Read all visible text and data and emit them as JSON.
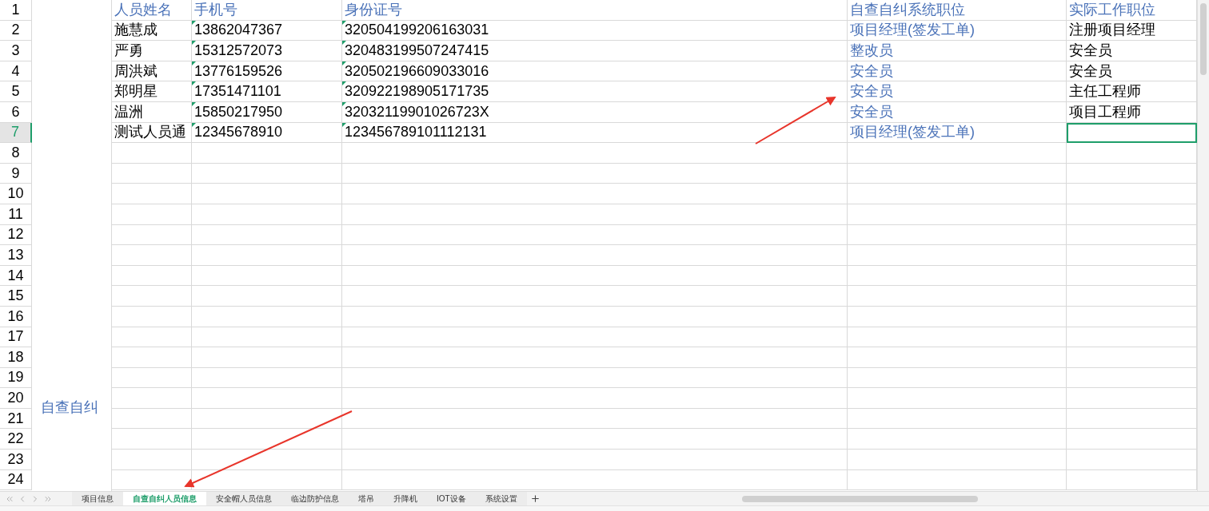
{
  "row_headers": [
    {
      "label": "1",
      "selected": false
    },
    {
      "label": "2",
      "selected": false
    },
    {
      "label": "3",
      "selected": false
    },
    {
      "label": "4",
      "selected": false
    },
    {
      "label": "5",
      "selected": false
    },
    {
      "label": "6",
      "selected": false
    },
    {
      "label": "7",
      "selected": true
    },
    {
      "label": "8",
      "selected": false
    },
    {
      "label": "9",
      "selected": false
    },
    {
      "label": "10",
      "selected": false
    },
    {
      "label": "11",
      "selected": false
    },
    {
      "label": "12",
      "selected": false
    },
    {
      "label": "13",
      "selected": false
    },
    {
      "label": "14",
      "selected": false
    },
    {
      "label": "15",
      "selected": false
    },
    {
      "label": "16",
      "selected": false
    },
    {
      "label": "17",
      "selected": false
    },
    {
      "label": "18",
      "selected": false
    },
    {
      "label": "19",
      "selected": false
    },
    {
      "label": "20",
      "selected": false
    },
    {
      "label": "21",
      "selected": false
    },
    {
      "label": "22",
      "selected": false
    },
    {
      "label": "23",
      "selected": false
    },
    {
      "label": "24",
      "selected": false
    }
  ],
  "merged_cell": "自查自纠",
  "table": {
    "rows": [
      [
        {
          "text": "人员姓名",
          "flag": false,
          "selected": false
        },
        {
          "text": "手机号",
          "flag": false,
          "selected": false
        },
        {
          "text": "身份证号",
          "flag": false,
          "selected": false
        },
        {
          "text": "自查自纠系统职位",
          "flag": false,
          "selected": false
        },
        {
          "text": "实际工作职位",
          "flag": false,
          "selected": false
        }
      ],
      [
        {
          "text": "施慧成",
          "flag": false,
          "selected": false
        },
        {
          "text": "13862047367",
          "flag": true,
          "selected": false
        },
        {
          "text": "320504199206163031",
          "flag": true,
          "selected": false
        },
        {
          "text": "项目经理(签发工单)",
          "flag": false,
          "selected": false
        },
        {
          "text": "注册项目经理",
          "flag": false,
          "selected": false
        }
      ],
      [
        {
          "text": "严勇",
          "flag": false,
          "selected": false
        },
        {
          "text": "15312572073",
          "flag": true,
          "selected": false
        },
        {
          "text": "320483199507247415",
          "flag": true,
          "selected": false
        },
        {
          "text": "整改员",
          "flag": false,
          "selected": false
        },
        {
          "text": "安全员",
          "flag": false,
          "selected": false
        }
      ],
      [
        {
          "text": "周洪斌",
          "flag": false,
          "selected": false
        },
        {
          "text": "13776159526",
          "flag": true,
          "selected": false
        },
        {
          "text": "320502196609033016",
          "flag": true,
          "selected": false
        },
        {
          "text": "安全员",
          "flag": false,
          "selected": false
        },
        {
          "text": "安全员",
          "flag": false,
          "selected": false
        }
      ],
      [
        {
          "text": "郑明星",
          "flag": false,
          "selected": false
        },
        {
          "text": "17351471101",
          "flag": true,
          "selected": false
        },
        {
          "text": "320922198905171735",
          "flag": true,
          "selected": false
        },
        {
          "text": "安全员",
          "flag": false,
          "selected": false
        },
        {
          "text": "主任工程师",
          "flag": false,
          "selected": false
        }
      ],
      [
        {
          "text": "温洲",
          "flag": false,
          "selected": false
        },
        {
          "text": "15850217950",
          "flag": true,
          "selected": false
        },
        {
          "text": "32032119901026723X",
          "flag": true,
          "selected": false
        },
        {
          "text": "安全员",
          "flag": false,
          "selected": false
        },
        {
          "text": "项目工程师",
          "flag": false,
          "selected": false
        }
      ],
      [
        {
          "text": "测试人员通",
          "flag": false,
          "selected": false
        },
        {
          "text": "12345678910",
          "flag": true,
          "selected": false
        },
        {
          "text": "123456789101112131",
          "flag": true,
          "selected": false
        },
        {
          "text": "项目经理(签发工单)",
          "flag": false,
          "selected": false
        },
        {
          "flag": false,
          "selected": true
        }
      ]
    ]
  },
  "sheet_tabs": [
    {
      "label": "项目信息",
      "selected": false
    },
    {
      "label": "自查自纠人员信息",
      "selected": true
    },
    {
      "label": "安全帽人员信息",
      "selected": false
    },
    {
      "label": "临边防护信息",
      "selected": false
    },
    {
      "label": "塔吊",
      "selected": false
    },
    {
      "label": "升降机",
      "selected": false
    },
    {
      "label": "IOT设备",
      "selected": false
    },
    {
      "label": "系统设置",
      "selected": false
    }
  ]
}
